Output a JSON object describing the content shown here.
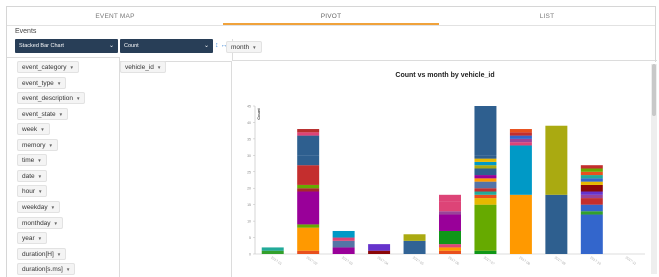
{
  "tabs": [
    {
      "label": "EVENT MAP",
      "active": false
    },
    {
      "label": "PIVOT",
      "active": true
    },
    {
      "label": "LIST",
      "active": false
    }
  ],
  "events_label": "Events",
  "renderer": {
    "selected": "Stacked Bar Chart"
  },
  "aggregator": {
    "selected": "Count"
  },
  "column_fields": [
    "month"
  ],
  "row_fields": [
    "vehicle_id"
  ],
  "unused_fields": [
    "event_category",
    "event_type",
    "event_description",
    "event_state",
    "week",
    "memory",
    "time",
    "date",
    "hour",
    "weekday",
    "monthday",
    "year",
    "duration[H]",
    "duration[s.ms]"
  ],
  "colors": {
    "tab_active_underline": "#f0a23b",
    "select_bg": "#283e57",
    "series_palette": [
      "#e8501e",
      "#ff9900",
      "#a52a2a",
      "#990099",
      "#33a02c",
      "#1f5fbf",
      "#2e5f8f",
      "#109618",
      "#dd4477",
      "#aaaa11",
      "#0099c6",
      "#c42e2e",
      "#66aa00",
      "#3366cc",
      "#b82e2e",
      "#5574a6",
      "#994499",
      "#22aa99",
      "#e6b800",
      "#316395",
      "#8b0707",
      "#6633cc"
    ]
  },
  "chart_data": {
    "type": "bar",
    "stacked": true,
    "title": "Count vs month by vehicle_id",
    "ylabel": "Count",
    "xlabel": "",
    "ylim": [
      0,
      45
    ],
    "yticks": [
      0,
      5,
      10,
      15,
      20,
      25,
      30,
      35,
      40,
      45
    ],
    "categories": [
      "2017-01",
      "2017-02",
      "2017-03",
      "2017-04",
      "2017-05",
      "2017-06",
      "2017-07",
      "2017-08",
      "2017-09",
      "2017-10",
      "2017-11"
    ],
    "stacks": [
      [
        {
          "value": 1,
          "color": "#33a02c"
        },
        {
          "value": 1,
          "color": "#22aa99"
        }
      ],
      [
        {
          "value": 1,
          "color": "#e8501e"
        },
        {
          "value": 7,
          "color": "#ff9900"
        },
        {
          "value": 1,
          "color": "#66aa00"
        },
        {
          "value": 10,
          "color": "#990099"
        },
        {
          "value": 1,
          "color": "#a52a2a"
        },
        {
          "value": 1,
          "color": "#66aa00"
        },
        {
          "value": 6,
          "color": "#c42e2e"
        },
        {
          "value": 3,
          "color": "#2e5f8f"
        },
        {
          "value": 6,
          "color": "#2e5f8f"
        },
        {
          "value": 1,
          "color": "#dd4477"
        },
        {
          "value": 1,
          "color": "#b82e2e"
        }
      ],
      [
        {
          "value": 2,
          "color": "#990099"
        },
        {
          "value": 2,
          "color": "#5574a6"
        },
        {
          "value": 1,
          "color": "#dd4477"
        },
        {
          "value": 2,
          "color": "#0099c6"
        }
      ],
      [
        {
          "value": 1,
          "color": "#8b0707"
        },
        {
          "value": 2,
          "color": "#6633cc"
        }
      ],
      [
        {
          "value": 4,
          "color": "#316395"
        },
        {
          "value": 2,
          "color": "#aaaa11"
        }
      ],
      [
        {
          "value": 1,
          "color": "#e8501e"
        },
        {
          "value": 1,
          "color": "#ff9900"
        },
        {
          "value": 1,
          "color": "#dd4477"
        },
        {
          "value": 4,
          "color": "#109618"
        },
        {
          "value": 5,
          "color": "#990099"
        },
        {
          "value": 1,
          "color": "#994499"
        },
        {
          "value": 3,
          "color": "#dd4477"
        },
        {
          "value": 2,
          "color": "#dd4477"
        }
      ],
      [
        {
          "value": 1,
          "color": "#109618"
        },
        {
          "value": 14,
          "color": "#66aa00"
        },
        {
          "value": 2,
          "color": "#e6b800"
        },
        {
          "value": 1,
          "color": "#e8501e"
        },
        {
          "value": 1,
          "color": "#22aa99"
        },
        {
          "value": 1,
          "color": "#c42e2e"
        },
        {
          "value": 2,
          "color": "#5574a6"
        },
        {
          "value": 1,
          "color": "#ff9900"
        },
        {
          "value": 1,
          "color": "#990099"
        },
        {
          "value": 2,
          "color": "#2e5f8f"
        },
        {
          "value": 1,
          "color": "#aaaa11"
        },
        {
          "value": 1,
          "color": "#0099c6"
        },
        {
          "value": 1,
          "color": "#e6b800"
        },
        {
          "value": 1,
          "color": "#2e5f8f"
        },
        {
          "value": 15,
          "color": "#2e5f8f"
        }
      ],
      [
        {
          "value": 18,
          "color": "#ff9900"
        },
        {
          "value": 15,
          "color": "#0099c6"
        },
        {
          "value": 1,
          "color": "#dd4477"
        },
        {
          "value": 1,
          "color": "#994499"
        },
        {
          "value": 1,
          "color": "#3366cc"
        },
        {
          "value": 1,
          "color": "#c42e2e"
        },
        {
          "value": 1,
          "color": "#e8501e"
        }
      ],
      [
        {
          "value": 18,
          "color": "#2e5f8f"
        },
        {
          "value": 21,
          "color": "#aaaa11"
        }
      ],
      [
        {
          "value": 12,
          "color": "#3366cc"
        },
        {
          "value": 1,
          "color": "#33a02c"
        },
        {
          "value": 2,
          "color": "#3366cc"
        },
        {
          "value": 2,
          "color": "#c42e2e"
        },
        {
          "value": 1,
          "color": "#994499"
        },
        {
          "value": 1,
          "color": "#6633cc"
        },
        {
          "value": 2,
          "color": "#8b0707"
        },
        {
          "value": 1,
          "color": "#e6b800"
        },
        {
          "value": 1,
          "color": "#3366cc"
        },
        {
          "value": 1,
          "color": "#22aa99"
        },
        {
          "value": 1,
          "color": "#e8501e"
        },
        {
          "value": 1,
          "color": "#66aa00"
        },
        {
          "value": 1,
          "color": "#c42e2e"
        }
      ]
    ]
  }
}
